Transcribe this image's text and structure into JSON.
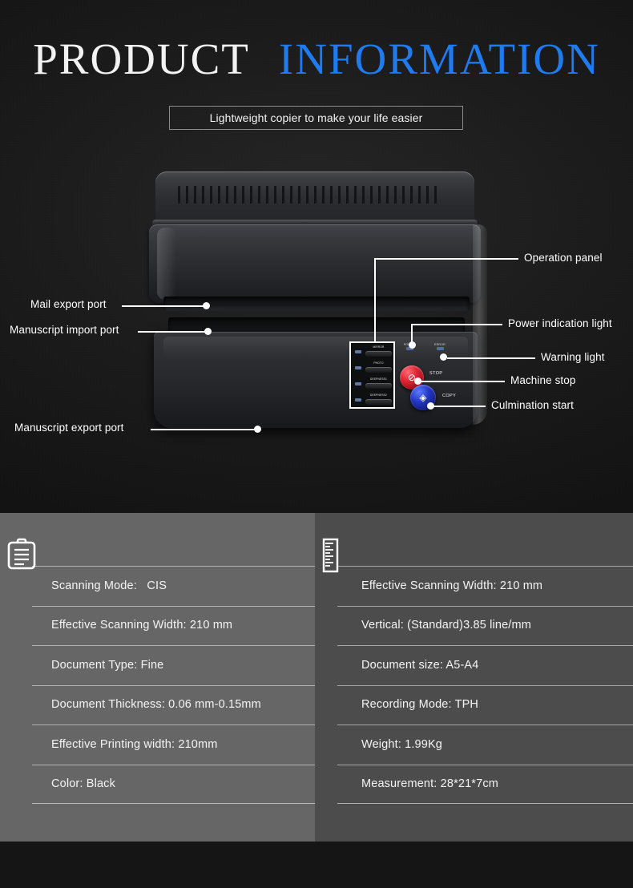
{
  "header": {
    "title_primary": "PRODUCT",
    "title_accent": "INFORMATION",
    "subtitle": "Lightweight copier to make your life easier"
  },
  "colors": {
    "accent_blue": "#1e7cf0",
    "background_dark": "#151515",
    "panel_left": "#666666",
    "panel_right": "#4c4c4c",
    "stop_button": "#e02433",
    "copy_button": "#2436c4"
  },
  "callouts": {
    "left": [
      {
        "label": "Mail export port"
      },
      {
        "label": "Manuscript import port"
      },
      {
        "label": "Manuscript export port"
      }
    ],
    "right": [
      {
        "label": "Operation panel"
      },
      {
        "label": "Power indication light"
      },
      {
        "label": "Warning light"
      },
      {
        "label": "Machine stop"
      },
      {
        "label": "Culmination start"
      }
    ]
  },
  "control_panel": {
    "keys": [
      {
        "label": "MIRROR"
      },
      {
        "label": "PHOTO"
      },
      {
        "label": "DEEPNESS1"
      },
      {
        "label": "DEEPNESS2"
      }
    ],
    "indicators": [
      {
        "label": "POWER"
      },
      {
        "label": "ERROR"
      }
    ],
    "stop_label": "STOP",
    "copy_label": "COPY",
    "stop_glyph": "⊘",
    "copy_glyph": "◈"
  },
  "specs": {
    "left": {
      "icon": "clipboard-icon",
      "rows": [
        "Scanning Mode:   CIS",
        "Effective Scanning Width: 210 mm",
        "Document Type: Fine",
        "Document Thickness: 0.06 mm-0.15mm",
        "Effective Printing width: 210mm",
        "Color: Black"
      ]
    },
    "right": {
      "icon": "ruler-icon",
      "rows": [
        "Effective Scanning Width: 210 mm",
        "Vertical: (Standard)3.85 line/mm",
        "Document size: A5-A4",
        "Recording Mode: TPH",
        "Weight: 1.99Kg",
        "Measurement: 28*21*7cm"
      ]
    }
  }
}
